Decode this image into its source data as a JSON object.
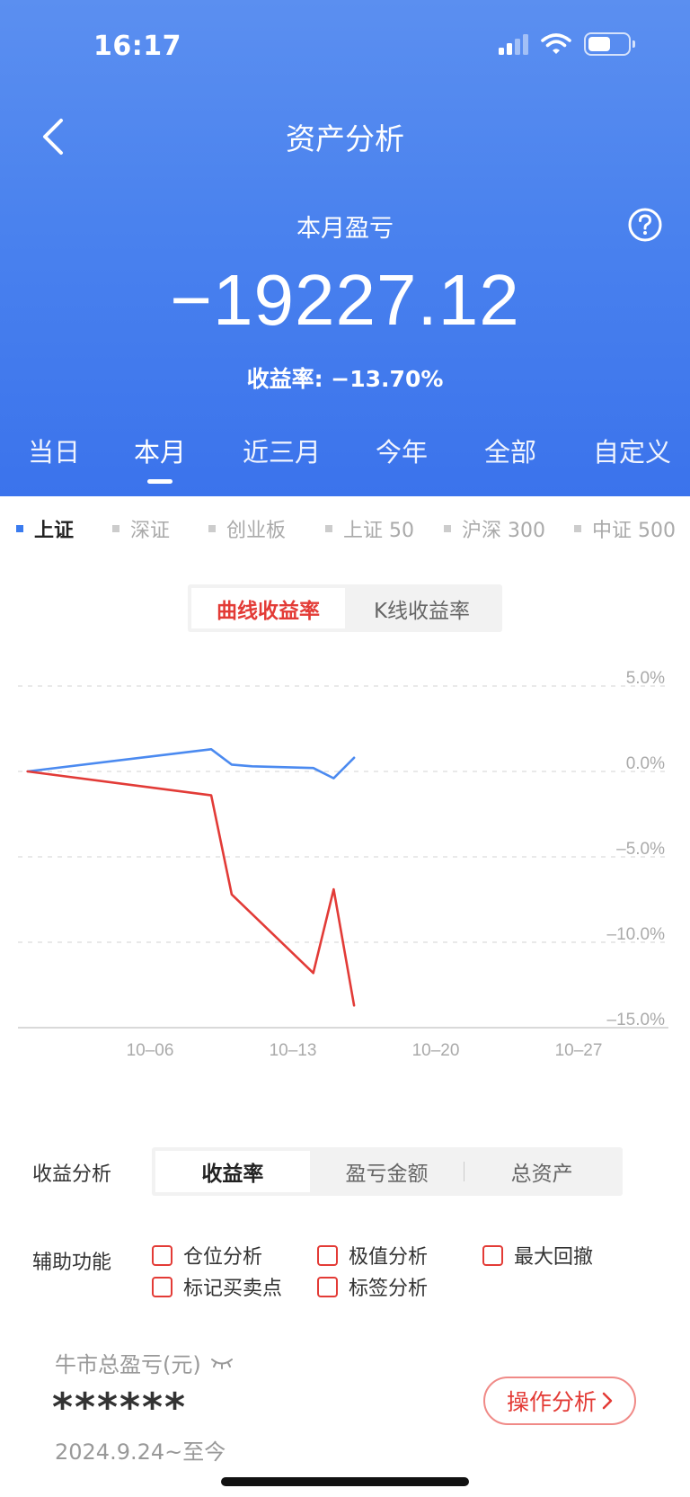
{
  "status_bar": {
    "time": "16:17"
  },
  "nav": {
    "title": "资产分析"
  },
  "summary": {
    "label": "本月盈亏",
    "value": "−19227.12",
    "rate_text": "收益率: −13.70%"
  },
  "period_tabs": [
    {
      "label": "当日",
      "active": false
    },
    {
      "label": "本月",
      "active": true
    },
    {
      "label": "近三月",
      "active": false
    },
    {
      "label": "今年",
      "active": false
    },
    {
      "label": "全部",
      "active": false
    },
    {
      "label": "自定义",
      "active": false
    }
  ],
  "index_filters": [
    {
      "label": "上证",
      "active": true
    },
    {
      "label": "深证",
      "active": false
    },
    {
      "label": "创业板",
      "active": false
    },
    {
      "label": "上证 50",
      "active": false
    },
    {
      "label": "沪深 300",
      "active": false
    },
    {
      "label": "中证 500",
      "active": false
    }
  ],
  "chart_switch": {
    "options": [
      "曲线收益率",
      "K线收益率"
    ],
    "active": 0
  },
  "chart_data": {
    "type": "line",
    "title": "",
    "xlabel": "",
    "ylabel": "",
    "x_tick_labels": [
      "10-06",
      "10-13",
      "10-20",
      "10-27"
    ],
    "y_tick_labels": [
      "5.0%",
      "0.0%",
      "-5.0%",
      "-10.0%",
      "-15.0%"
    ],
    "ylim": [
      -15,
      5
    ],
    "grid": true,
    "series": [
      {
        "color": "#4b8af0",
        "points": [
          {
            "x": "2024-09-30",
            "y": 0.0
          },
          {
            "x": "2024-10-09",
            "y": 1.3
          },
          {
            "x": "2024-10-10",
            "y": 0.4
          },
          {
            "x": "2024-10-11",
            "y": 0.3
          },
          {
            "x": "2024-10-14",
            "y": 0.2
          },
          {
            "x": "2024-10-15",
            "y": -0.4
          },
          {
            "x": "2024-10-16",
            "y": 0.8
          }
        ]
      },
      {
        "color": "#e23b37",
        "points": [
          {
            "x": "2024-09-30",
            "y": 0.0
          },
          {
            "x": "2024-10-09",
            "y": -1.4
          },
          {
            "x": "2024-10-10",
            "y": -7.2
          },
          {
            "x": "2024-10-14",
            "y": -11.8
          },
          {
            "x": "2024-10-15",
            "y": -6.9
          },
          {
            "x": "2024-10-16",
            "y": -13.7
          }
        ]
      }
    ]
  },
  "analysis": {
    "label": "收益分析",
    "options": [
      "收益率",
      "盈亏金额",
      "总资产"
    ],
    "active": 0
  },
  "aux": {
    "label": "辅助功能",
    "items": [
      "仓位分析",
      "极值分析",
      "最大回撤",
      "标记买卖点",
      "标签分析"
    ]
  },
  "bull": {
    "title": "牛市总盈亏(元)",
    "masked_value": "******",
    "date_range": "2024.9.24~至今",
    "button_label": "操作分析"
  },
  "colors": {
    "accent_red": "#e33b36",
    "brand_blue": "#3b73ec"
  }
}
